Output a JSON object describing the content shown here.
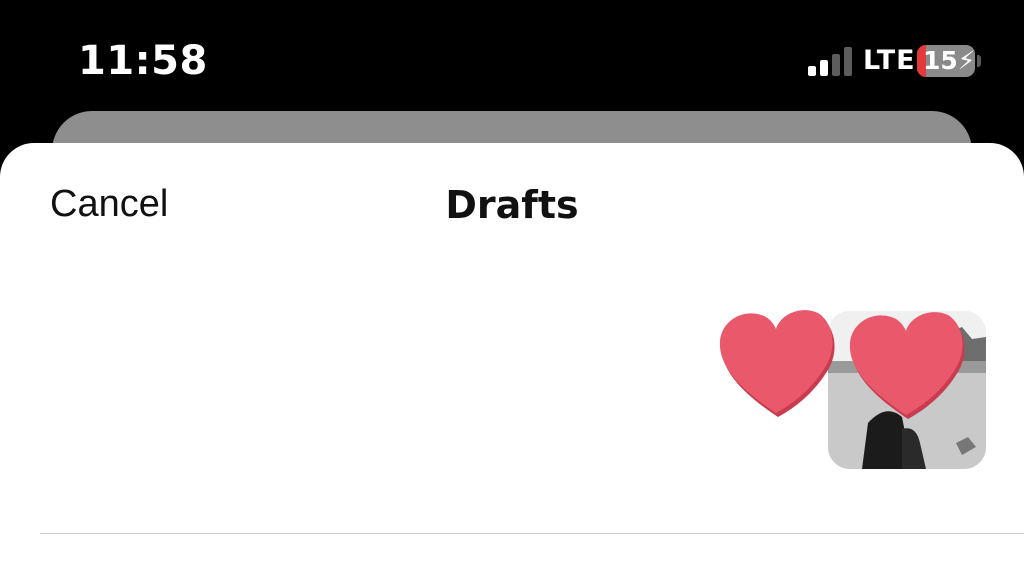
{
  "status_bar": {
    "time": "11:58",
    "network": "LTE",
    "battery_level": "15",
    "signal_bars_active": 2,
    "signal_bars_total": 4,
    "battery_fraction": 0.15,
    "battery_color": "#e5383b"
  },
  "header": {
    "cancel_label": "Cancel",
    "title": "Drafts"
  },
  "drafts": [
    {
      "thumbnail": "draft-photo",
      "overlay_icon": "heart-icon"
    }
  ],
  "colors": {
    "heart": "#e9586b"
  }
}
